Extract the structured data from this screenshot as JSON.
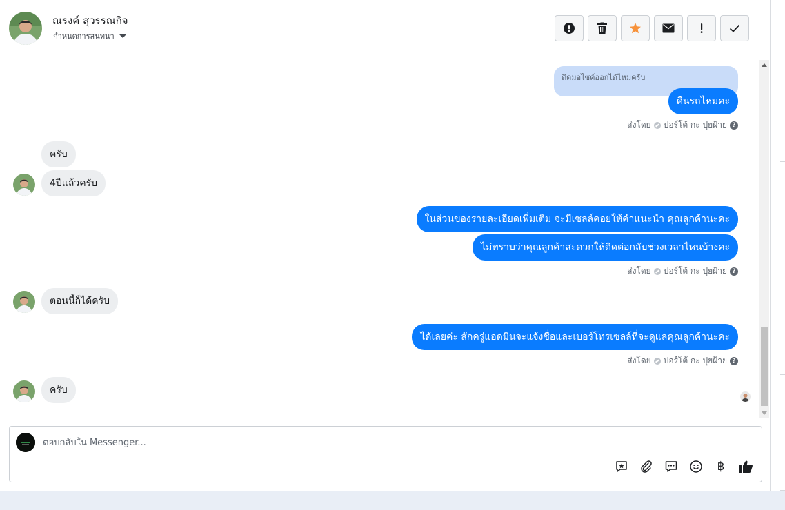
{
  "header": {
    "contact_name": "ณรงค์ สุวรรณกิจ",
    "assign_label": "กำหนดการสนทนา"
  },
  "toolbar": {
    "buttons": [
      {
        "icon": "alert-circle-icon",
        "name": "mark-spam-button"
      },
      {
        "icon": "trash-icon",
        "name": "delete-button"
      },
      {
        "icon": "star-icon",
        "name": "star-button"
      },
      {
        "icon": "envelope-icon",
        "name": "mark-unread-button"
      },
      {
        "icon": "exclamation-icon",
        "name": "follow-up-button"
      },
      {
        "icon": "check-icon",
        "name": "mark-done-button"
      }
    ],
    "star_color": "#f7923b"
  },
  "messages": {
    "quote_text": "ติดมอไซค์ออกได้ไหมครับ",
    "m1": "คืนรถไหมคะ",
    "m2": "ครับ",
    "m3": "4ปีแล้วครับ",
    "m4": "ในส่วนของรายละเอียดเพิ่มเติม จะมีเซลล์คอยให้คำแนะนำ คุณลูกค้านะคะ",
    "m5": "ไม่ทราบว่าคุณลูกค้าสะดวกให้ติดต่อกลับช่วงเวลาไหนบ้างคะ",
    "m6": "ตอนนี้ก็ได้ครับ",
    "m7": "ได้เลยค่ะ สักครู่แอดมินจะแจ้งชื่อและเบอร์โทรเซลล์ที่จะดูแลคุณลูกค้านะคะ",
    "m8": "ครับ",
    "sent_by_label": "ส่งโดย",
    "sent_by_name": "ปอร์โต้ กะ ปุยฝ้าย"
  },
  "composer": {
    "placeholder": "ตอบกลับใน Messenger...",
    "icons": [
      "saved-reply-icon",
      "paperclip-icon",
      "chat-bubble-icon",
      "emoji-icon",
      "baht-icon",
      "thumbs-up-icon"
    ],
    "baht_glyph": "฿"
  },
  "colors": {
    "outgoing_bubble": "#0a7cff",
    "incoming_bubble": "#eceef0",
    "quoted_bubble": "#c9dcf9"
  }
}
